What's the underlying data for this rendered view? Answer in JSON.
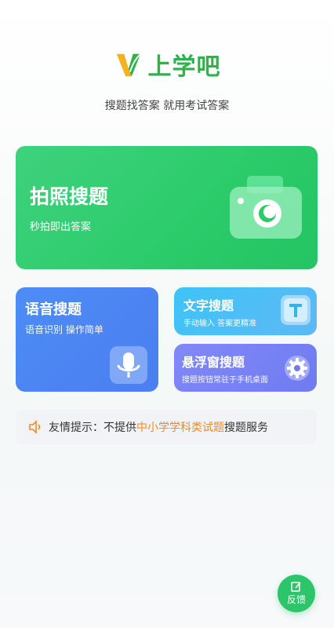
{
  "header": {
    "logo_text": "上学吧",
    "slogan": "搜题找答案 就用考试答案"
  },
  "cards": {
    "photo": {
      "title": "拍照搜题",
      "subtitle": "秒拍即出答案",
      "icon": "camera-icon"
    },
    "voice": {
      "title": "语音搜题",
      "subtitle": "语音识别 操作简单",
      "icon": "microphone-icon"
    },
    "text": {
      "title": "文字搜题",
      "subtitle": "手动输入 答案更精准",
      "icon": "text-t-icon"
    },
    "float": {
      "title": "悬浮窗搜题",
      "subtitle": "搜题按钮常驻于手机桌面",
      "icon": "gear-icon"
    }
  },
  "tip": {
    "prefix": "友情提示：不提供",
    "highlight": "中小学学科类试题",
    "suffix": "搜题服务",
    "highlight_color": "#f08a24"
  },
  "feedback": {
    "label": "反馈"
  },
  "colors": {
    "brand_green": "#2cc56a",
    "voice_blue": "#4d8cf6",
    "text_cyan": "#3dc4f6",
    "float_purple": "#7b83f2"
  }
}
